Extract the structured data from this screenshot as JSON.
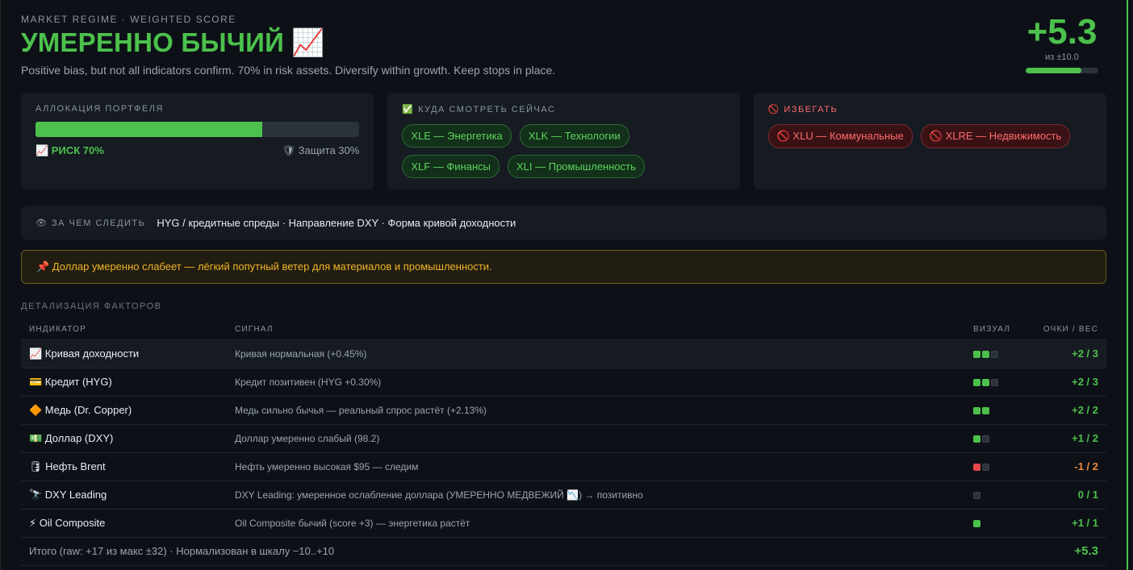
{
  "header": {
    "kicker": "MARKET REGIME · WEIGHTED SCORE",
    "title": "УМЕРЕННО БЫЧИЙ 📈",
    "subtitle": "Positive bias, but not all indicators confirm. 70% in risk assets. Diversify within growth. Keep stops in place.",
    "score": "+5.3",
    "score_of": "из ±10.0",
    "score_fraction": 0.765
  },
  "allocation": {
    "label": "АЛЛОКАЦИЯ ПОРТФЕЛЯ",
    "risk_fraction": 0.7,
    "risk_label": "📈 РИСК 70%",
    "protect_label": "🛡 Защита 30%"
  },
  "watch": {
    "label": "✅ КУДА СМОТРЕТЬ СЕЙЧАС",
    "chips": [
      "XLE — Энергетика",
      "XLK — Технологии",
      "XLF — Финансы",
      "XLI — Промышленность"
    ]
  },
  "avoid": {
    "label": "🚫 ИЗБЕГАТЬ",
    "chips": [
      "🚫 XLU — Коммунальные",
      "🚫 XLRE — Недвижимость"
    ]
  },
  "watchline": {
    "label": "👁 ЗА ЧЕМ СЛЕДИТЬ",
    "text": "HYG / кредитные спреды · Направление DXY · Форма кривой доходности"
  },
  "note": "📌 Доллар умеренно слабеет — лёгкий попутный ветер для материалов и промышленности.",
  "factors": {
    "label": "ДЕТАЛИЗАЦИЯ ФАКТОРОВ",
    "columns": [
      "ИНДИКАТОР",
      "СИГНАЛ",
      "ВИЗУАЛ",
      "ОЧКИ / ВЕС"
    ],
    "rows": [
      {
        "indicator": "📈 Кривая доходности",
        "signal": "Кривая нормальная (+0.45%)",
        "points": "+2 / 3"
      },
      {
        "indicator": "💳 Кредит (HYG)",
        "signal": "Кредит позитивен (HYG +0.30%)",
        "points": "+2 / 3"
      },
      {
        "indicator": "🔶 Медь (Dr. Copper)",
        "signal": "Медь сильно бычья — реальный спрос растёт (+2.13%)",
        "points": "+2 / 2"
      },
      {
        "indicator": "💵 Доллар (DXY)",
        "signal": "Доллар умеренно слабый (98.2)",
        "points": "+1 / 2"
      },
      {
        "indicator": "🛢 Нефть Brent",
        "signal": "Нефть умеренно высокая $95 — следим",
        "points": "-1 / 2"
      },
      {
        "indicator": "🔭 DXY Leading",
        "signal": "DXY Leading: умеренное ослабление доллара (УМЕРЕННО МЕДВЕЖИЙ 📉) → позитивно",
        "points": "0 / 1"
      },
      {
        "indicator": "⚡ Oil Composite",
        "signal": "Oil Composite бычий (score +3) — энергетика растёт",
        "points": "+1 / 1"
      }
    ],
    "total_text": "Итого (raw: +17 из макс ±32) · Нормализован в шкалу −10..+10",
    "total_score": "+5.3"
  },
  "colors": {
    "accent": "#4cc14c",
    "negative": "#e5484d",
    "warning": "#f0b429"
  }
}
